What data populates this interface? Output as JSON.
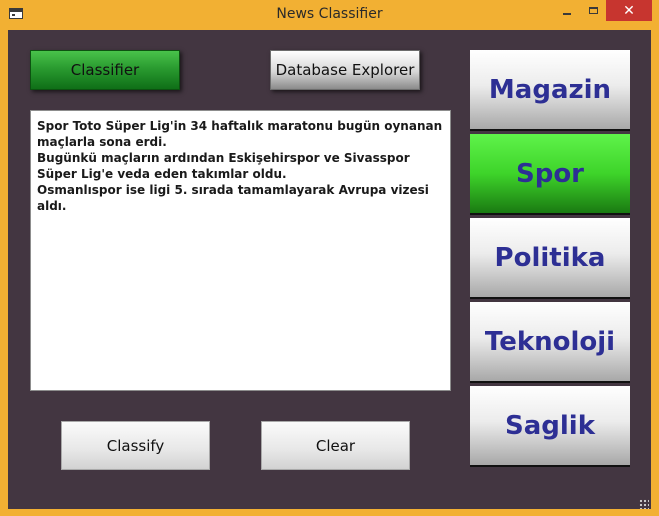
{
  "window": {
    "title": "News Classifier",
    "close_glyph": "✕"
  },
  "toolbar": {
    "classifier_label": "Classifier",
    "database_explorer_label": "Database Explorer"
  },
  "news_text": {
    "lines": [
      "Spor Toto Süper Lig'in 34 haftalık maratonu bugün oynanan maçlarla sona erdi.",
      "Bugünkü maçların ardından Eskişehirspor ve Sivasspor Süper Lig'e veda eden takımlar oldu.",
      "Osmanlıspor ise ligi 5. sırada tamamlayarak Avrupa vizesi aldı."
    ]
  },
  "actions": {
    "classify_label": "Classify",
    "clear_label": "Clear"
  },
  "categories": [
    {
      "label": "Magazin",
      "selected": false
    },
    {
      "label": "Spor",
      "selected": true
    },
    {
      "label": "Politika",
      "selected": false
    },
    {
      "label": "Teknoloji",
      "selected": false
    },
    {
      "label": "Saglik",
      "selected": false
    }
  ],
  "colors": {
    "titlebar": "#F2B033",
    "client_background": "#433641",
    "close_button": "#C7352F",
    "selected_category": "#3ED42A",
    "category_text": "#2D2F94"
  },
  "icons": {
    "app": "window-icon",
    "minimize": "minimize-icon",
    "maximize": "maximize-icon",
    "close": "close-icon"
  }
}
